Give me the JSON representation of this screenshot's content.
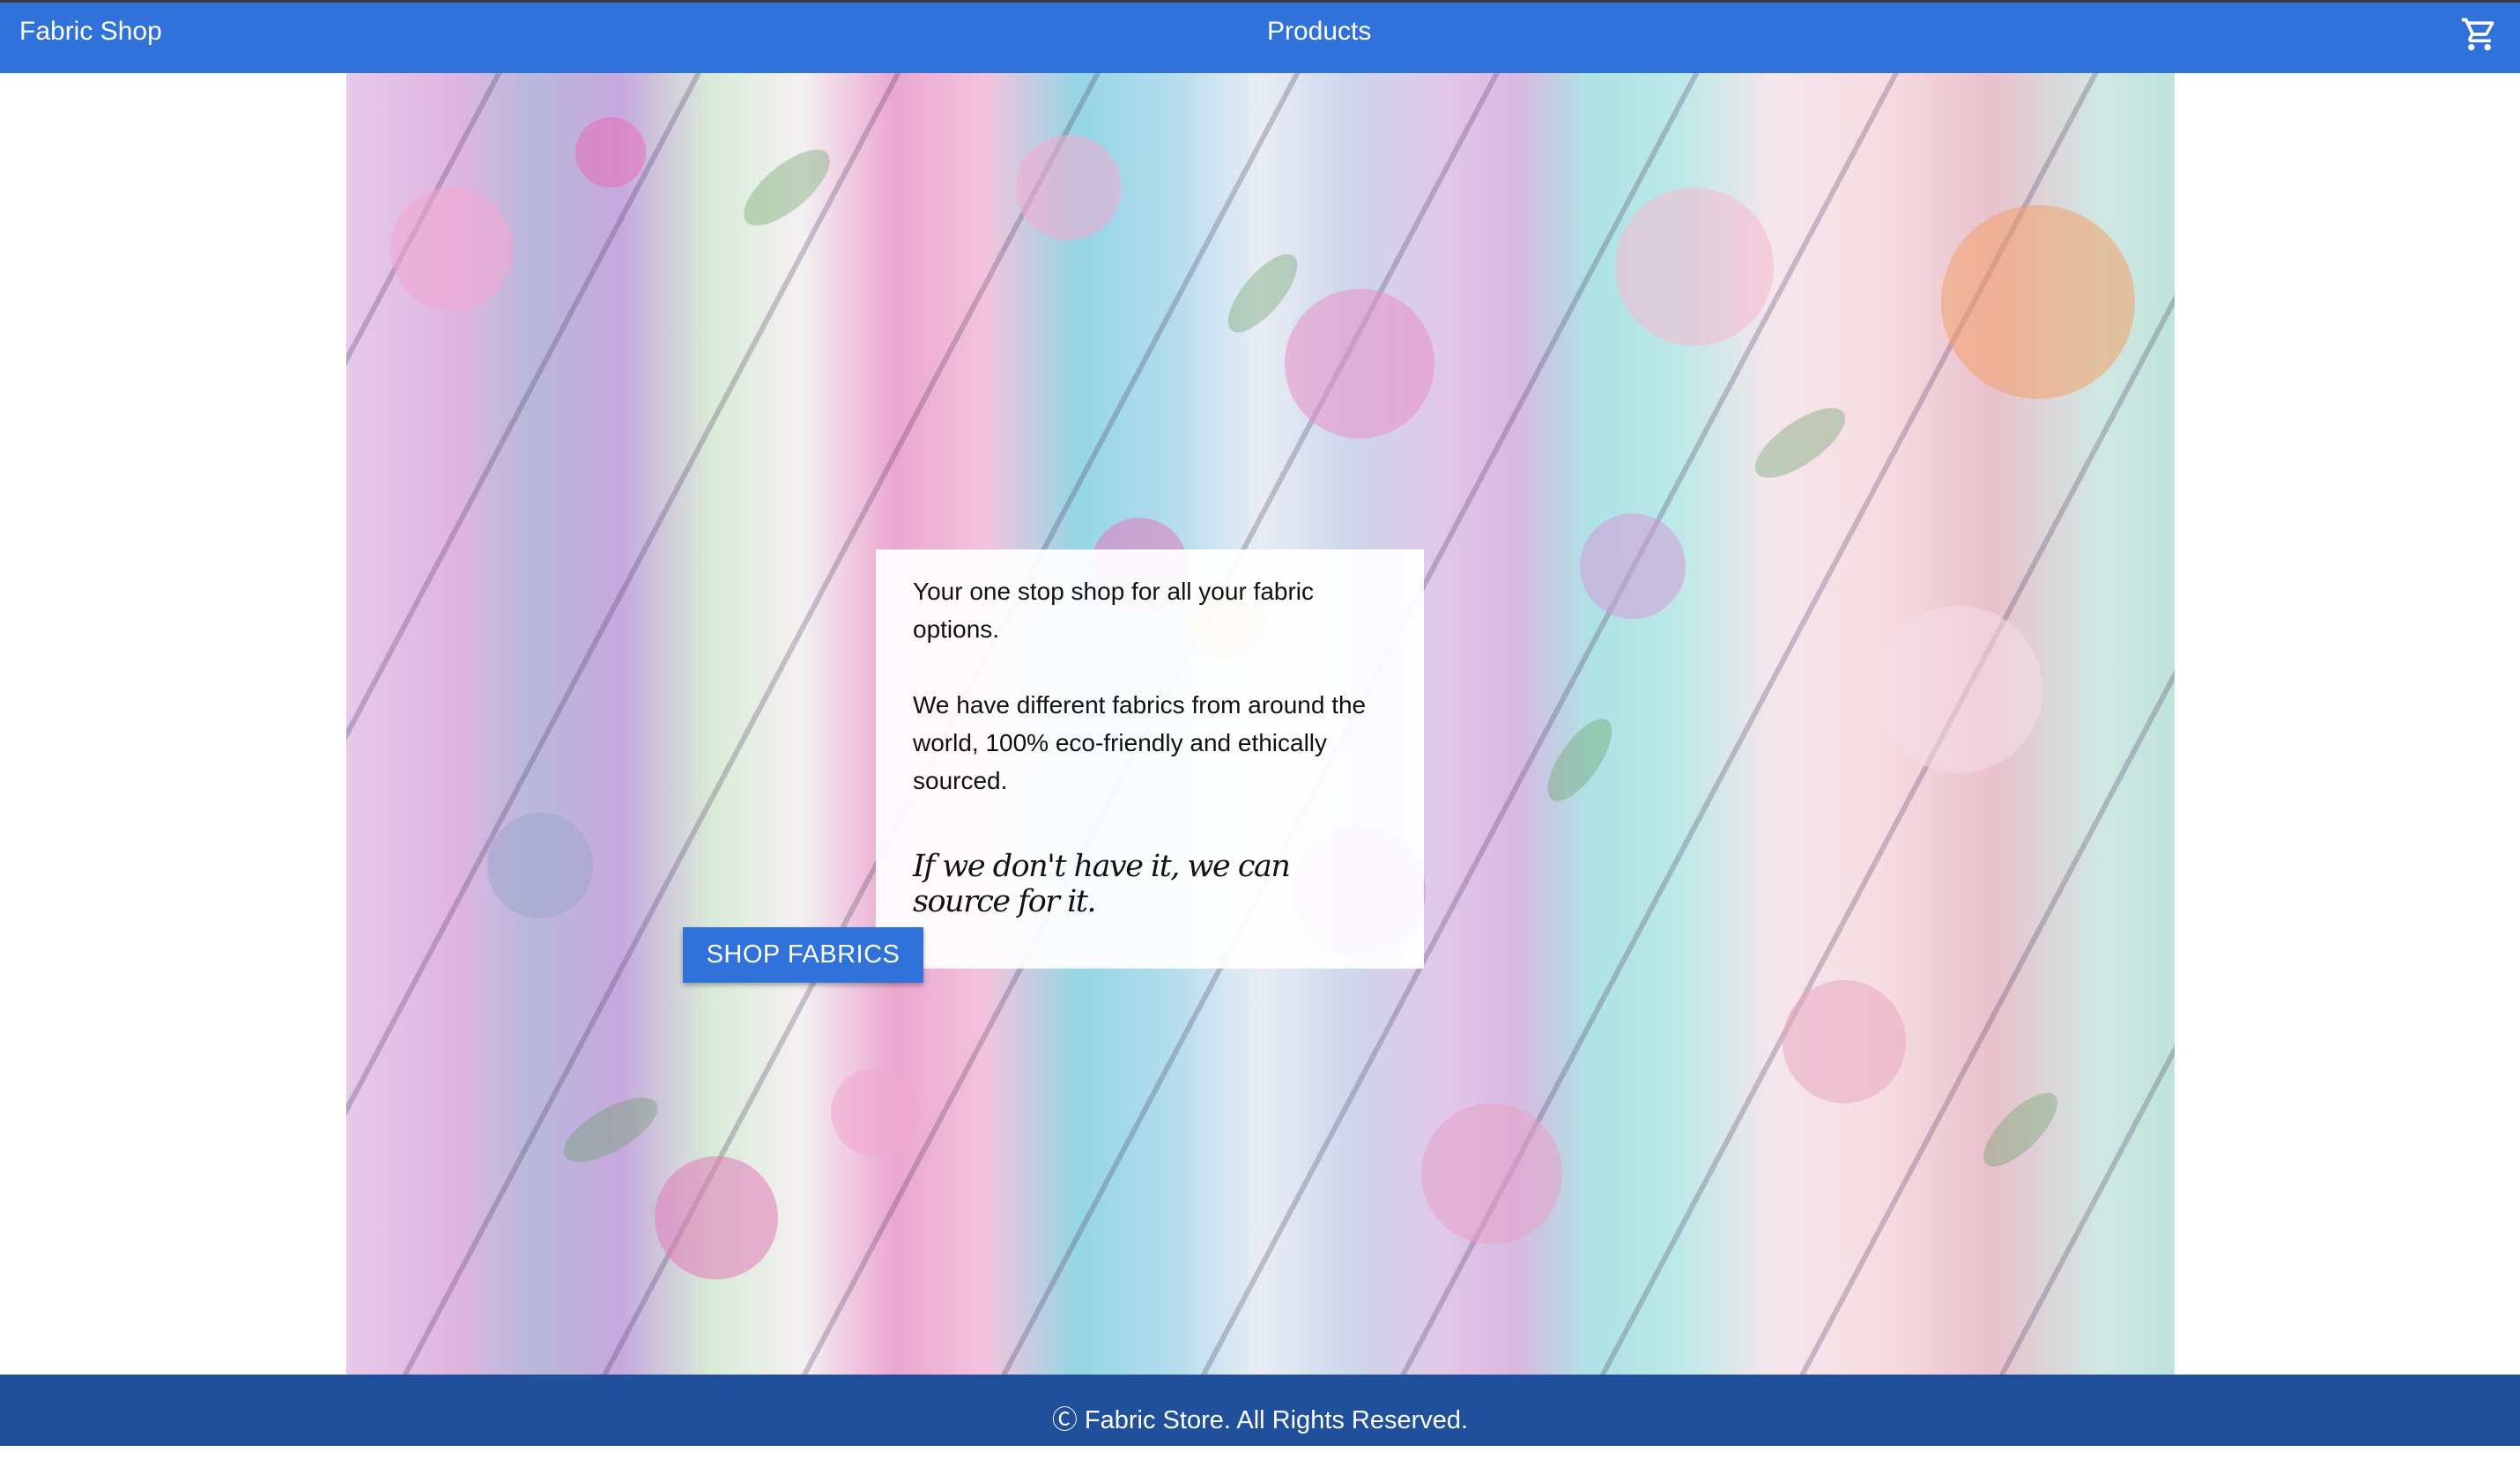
{
  "header": {
    "brand": "Fabric Shop",
    "nav_products": "Products",
    "cart_icon": "shopping-cart-icon"
  },
  "hero": {
    "intro": "Your one stop shop for all your fabric options.",
    "details": "We have different fabrics from around the world, 100% eco-friendly and ethically sourced.",
    "tagline": "If we don't have it, we can source for it.",
    "cta_label": "SHOP FABRICS"
  },
  "footer": {
    "copyright": "Ⓒ Fabric Store. All Rights Reserved."
  },
  "colors": {
    "primary": "#3072d9",
    "footer": "#204f9b",
    "text": "#111111"
  }
}
